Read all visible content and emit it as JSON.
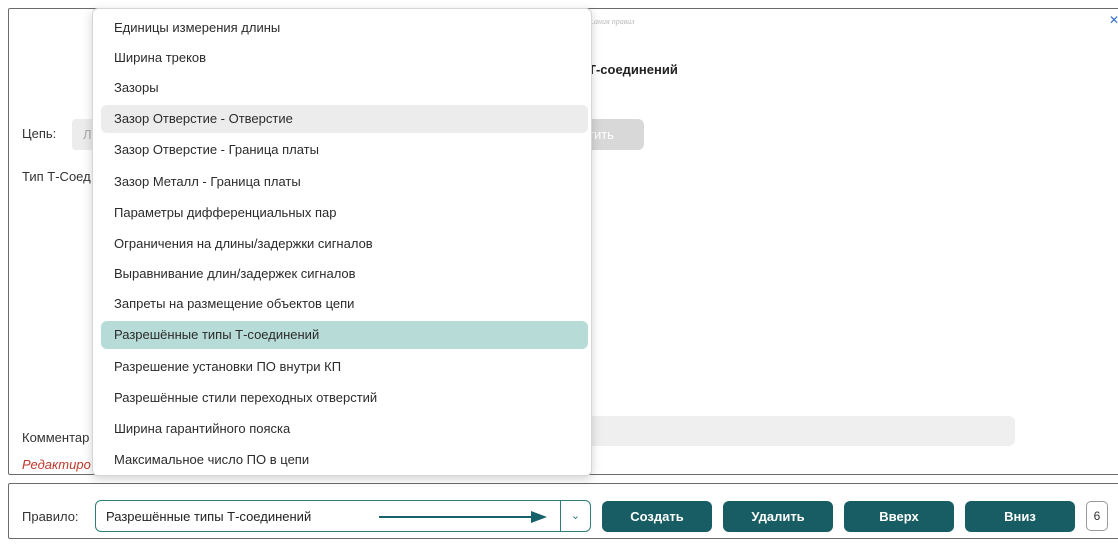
{
  "top_panel": {
    "faded_hint": "...ания правил",
    "title": "Т-соединений",
    "net_label": "Цепь:",
    "net_field_value": "Лю",
    "apply_button_label": "тить",
    "t_type_label": "Тип Т-Соед",
    "comment_label": "Комментар",
    "edit_link": "Редактиро"
  },
  "dropdown": {
    "items": [
      {
        "label": "Единицы измерения длины"
      },
      {
        "label": "Ширина треков"
      },
      {
        "label": "Зазоры"
      },
      {
        "label": "Зазор Отверстие - Отверстие",
        "state": "hover"
      },
      {
        "label": "Зазор Отверстие - Граница платы"
      },
      {
        "label": "Зазор Металл - Граница платы"
      },
      {
        "label": "Параметры дифференциальных пар"
      },
      {
        "label": "Ограничения на длины/задержки сигналов"
      },
      {
        "label": "Выравнивание длин/задержек сигналов"
      },
      {
        "label": "Запреты на размещение объектов цепи"
      },
      {
        "label": "Разрешённые типы Т-соединений",
        "state": "selected"
      },
      {
        "label": "Разрешение установки ПО внутри КП"
      },
      {
        "label": "Разрешённые стили переходных отверстий"
      },
      {
        "label": "Ширина гарантийного пояска"
      },
      {
        "label": "Максимальное число ПО в цепи"
      }
    ]
  },
  "bottom_bar": {
    "rule_label": "Правило:",
    "rule_value": "Разрешённые типы Т-соединений",
    "buttons": {
      "create": "Создать",
      "delete": "Удалить",
      "up": "Вверх",
      "down": "Вниз"
    },
    "counter": "6"
  },
  "icons": {
    "close": "close-icon",
    "dropdown": "chevron-down-icon",
    "annotation": "arrow-right-icon"
  },
  "colors": {
    "primary_button": "#175d63",
    "selected_item": "#b7dcd7",
    "hover_item": "#ececec",
    "select_border": "#2e7d7a",
    "edit_link": "#c0392b"
  }
}
